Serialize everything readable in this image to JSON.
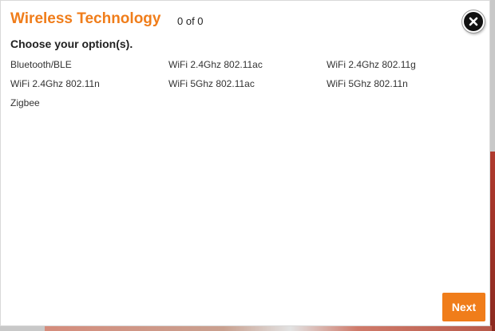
{
  "modal": {
    "title": "Wireless Technology",
    "counter": "0 of 0",
    "prompt": "Choose your option(s).",
    "close_icon": "close-icon",
    "options": [
      {
        "label": "Bluetooth/BLE"
      },
      {
        "label": "WiFi 2.4Ghz 802.11ac"
      },
      {
        "label": "WiFi 2.4Ghz 802.11g"
      },
      {
        "label": "WiFi 2.4Ghz 802.11n"
      },
      {
        "label": "WiFi 5Ghz 802.11ac"
      },
      {
        "label": "WiFi 5Ghz 802.11n"
      },
      {
        "label": "Zigbee"
      }
    ],
    "next_label": "Next"
  },
  "colors": {
    "accent": "#f07d1a",
    "text": "#333333",
    "close_bg": "#111111"
  }
}
